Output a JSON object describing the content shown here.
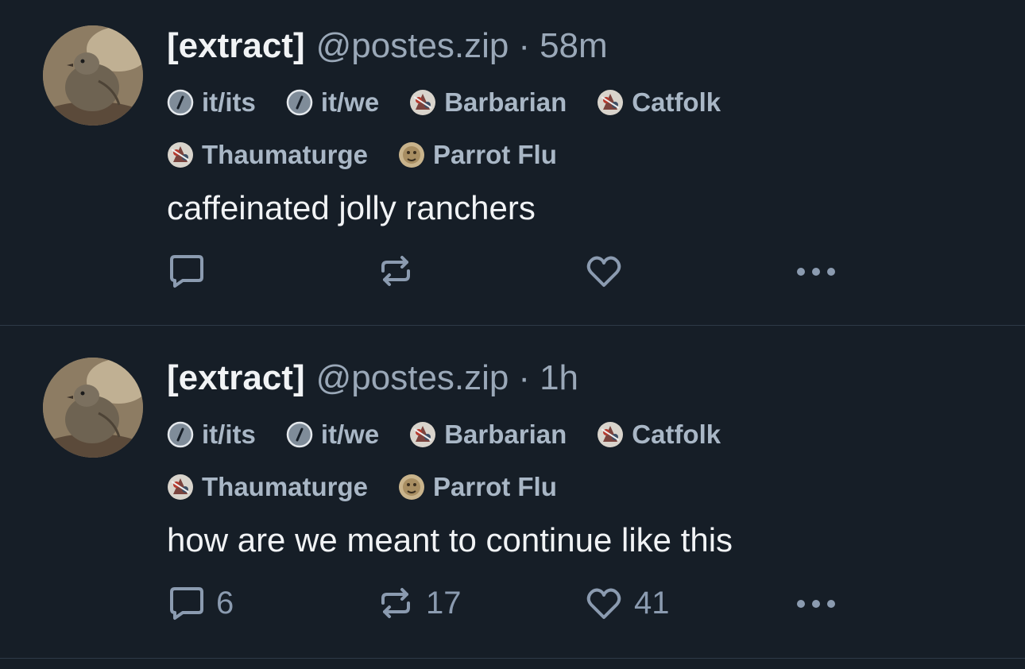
{
  "colors": {
    "background": "#161e27",
    "divider": "#2e3a47",
    "text_primary": "#f1f3f5",
    "text_secondary": "#9aa8b8",
    "label_text": "#a9b7c6",
    "action_icon": "#8b9bb0"
  },
  "posts": [
    {
      "display_name": "[extract]",
      "handle": "@postes.zip",
      "separator": "·",
      "time": "58m",
      "labels_row1": [
        {
          "text": "it/its",
          "icon": "slash-circle-icon"
        },
        {
          "text": "it/we",
          "icon": "slash-circle-icon"
        },
        {
          "text": "Barbarian",
          "icon": "labeler-avatar-icon"
        },
        {
          "text": "Catfolk",
          "icon": "labeler-avatar-icon"
        }
      ],
      "labels_row2": [
        {
          "text": "Thaumaturge",
          "icon": "labeler-avatar-icon"
        },
        {
          "text": "Parrot Flu",
          "icon": "parrot-labeler-icon"
        }
      ],
      "text": "caffeinated jolly ranchers",
      "reply_count": "",
      "repost_count": "",
      "like_count": ""
    },
    {
      "display_name": "[extract]",
      "handle": "@postes.zip",
      "separator": "·",
      "time": "1h",
      "labels_row1": [
        {
          "text": "it/its",
          "icon": "slash-circle-icon"
        },
        {
          "text": "it/we",
          "icon": "slash-circle-icon"
        },
        {
          "text": "Barbarian",
          "icon": "labeler-avatar-icon"
        },
        {
          "text": "Catfolk",
          "icon": "labeler-avatar-icon"
        }
      ],
      "labels_row2": [
        {
          "text": "Thaumaturge",
          "icon": "labeler-avatar-icon"
        },
        {
          "text": "Parrot Flu",
          "icon": "parrot-labeler-icon"
        }
      ],
      "text": "how are we meant to continue like this",
      "reply_count": "6",
      "repost_count": "17",
      "like_count": "41"
    }
  ]
}
